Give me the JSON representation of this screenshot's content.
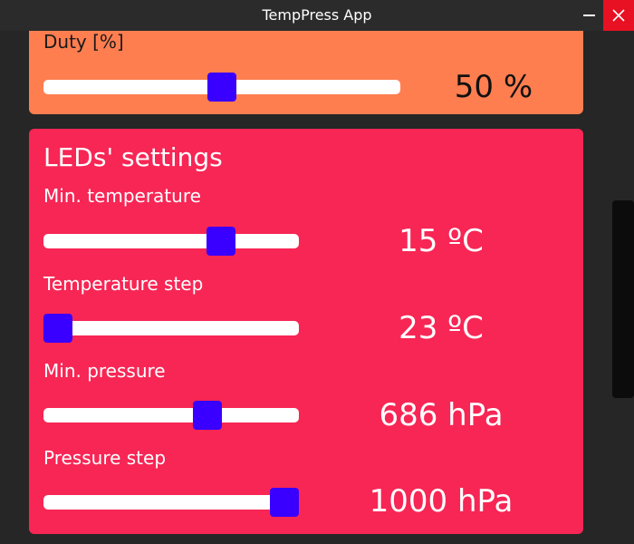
{
  "window": {
    "title": "TempPress App"
  },
  "duty": {
    "label": "Duty [%]",
    "value_text": "50 %",
    "fraction": 0.5
  },
  "leds": {
    "title": "LEDs' settings",
    "settings": [
      {
        "label": "Min. temperature",
        "value_text": "15 ºC",
        "fraction": 0.72
      },
      {
        "label": "Temperature step",
        "value_text": "23 ºC",
        "fraction": 0.0
      },
      {
        "label": "Min. pressure",
        "value_text": "686 hPa",
        "fraction": 0.66
      },
      {
        "label": "Pressure step",
        "value_text": "1000 hPa",
        "fraction": 1.0
      }
    ]
  },
  "colors": {
    "duty_card": "#ff7e50",
    "leds_card": "#f72655",
    "slider_thumb": "#3a00ff",
    "close_button": "#e81123"
  }
}
